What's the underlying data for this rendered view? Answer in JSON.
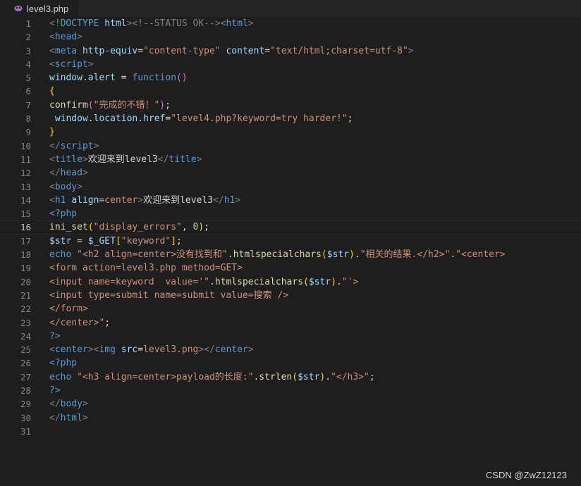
{
  "tab": {
    "filename": "level3.php",
    "icon": "php-file-icon"
  },
  "editor": {
    "current_line": 16,
    "lines": [
      {
        "n": "1",
        "tokens": [
          [
            "t-punc",
            "<!"
          ],
          [
            "t-tag",
            "DOCTYPE"
          ],
          [
            "t-plain",
            " "
          ],
          [
            "t-attr",
            "html"
          ],
          [
            "t-punc",
            "><!--STATUS OK--><"
          ],
          [
            "t-tag",
            "html"
          ],
          [
            "t-punc",
            ">"
          ]
        ]
      },
      {
        "n": "2",
        "tokens": [
          [
            "t-punc",
            "<"
          ],
          [
            "t-tag",
            "head"
          ],
          [
            "t-punc",
            ">"
          ]
        ]
      },
      {
        "n": "3",
        "tokens": [
          [
            "t-punc",
            "<"
          ],
          [
            "t-tag",
            "meta"
          ],
          [
            "t-plain",
            " "
          ],
          [
            "t-attr",
            "http-equiv"
          ],
          [
            "t-plain",
            "="
          ],
          [
            "t-str",
            "\"content-type\""
          ],
          [
            "t-plain",
            " "
          ],
          [
            "t-attr",
            "content"
          ],
          [
            "t-plain",
            "="
          ],
          [
            "t-str",
            "\"text/html;charset=utf-8\""
          ],
          [
            "t-punc",
            ">"
          ]
        ]
      },
      {
        "n": "4",
        "tokens": [
          [
            "t-punc",
            "<"
          ],
          [
            "t-tag",
            "script"
          ],
          [
            "t-punc",
            ">"
          ]
        ]
      },
      {
        "n": "5",
        "tokens": [
          [
            "t-var",
            "window"
          ],
          [
            "t-plain",
            "."
          ],
          [
            "t-var",
            "alert"
          ],
          [
            "t-plain",
            " = "
          ],
          [
            "t-kw",
            "function"
          ],
          [
            "t-paren",
            "()"
          ]
        ]
      },
      {
        "n": "6",
        "tokens": [
          [
            "t-brace",
            "{"
          ]
        ]
      },
      {
        "n": "7",
        "tokens": [
          [
            "t-fn",
            "confirm"
          ],
          [
            "t-paren",
            "("
          ],
          [
            "t-str",
            "\"完成的不错！\""
          ],
          [
            "t-paren",
            ")"
          ],
          [
            "t-plain",
            ";"
          ]
        ]
      },
      {
        "n": "8",
        "tokens": [
          [
            "t-plain",
            " "
          ],
          [
            "t-var",
            "window"
          ],
          [
            "t-plain",
            "."
          ],
          [
            "t-var",
            "location"
          ],
          [
            "t-plain",
            "."
          ],
          [
            "t-var",
            "href"
          ],
          [
            "t-plain",
            "="
          ],
          [
            "t-str",
            "\"level4.php?keyword=try harder!\""
          ],
          [
            "t-plain",
            ";"
          ]
        ]
      },
      {
        "n": "9",
        "tokens": [
          [
            "t-brace",
            "}"
          ]
        ]
      },
      {
        "n": "10",
        "tokens": [
          [
            "t-punc",
            "</"
          ],
          [
            "t-tag",
            "script"
          ],
          [
            "t-punc",
            ">"
          ]
        ]
      },
      {
        "n": "11",
        "tokens": [
          [
            "t-punc",
            "<"
          ],
          [
            "t-tag",
            "title"
          ],
          [
            "t-punc",
            ">"
          ],
          [
            "t-plain",
            "欢迎来到level3"
          ],
          [
            "t-punc",
            "</"
          ],
          [
            "t-tag",
            "title"
          ],
          [
            "t-punc",
            ">"
          ]
        ]
      },
      {
        "n": "12",
        "tokens": [
          [
            "t-punc",
            "</"
          ],
          [
            "t-tag",
            "head"
          ],
          [
            "t-punc",
            ">"
          ]
        ]
      },
      {
        "n": "13",
        "tokens": [
          [
            "t-punc",
            "<"
          ],
          [
            "t-tag",
            "body"
          ],
          [
            "t-punc",
            ">"
          ]
        ]
      },
      {
        "n": "14",
        "tokens": [
          [
            "t-punc",
            "<"
          ],
          [
            "t-tag",
            "h1"
          ],
          [
            "t-plain",
            " "
          ],
          [
            "t-attr",
            "align"
          ],
          [
            "t-plain",
            "="
          ],
          [
            "t-str",
            "center"
          ],
          [
            "t-punc",
            ">"
          ],
          [
            "t-plain",
            "欢迎来到level3"
          ],
          [
            "t-punc",
            "</"
          ],
          [
            "t-tag",
            "h1"
          ],
          [
            "t-punc",
            ">"
          ]
        ]
      },
      {
        "n": "15",
        "tokens": [
          [
            "t-php",
            "<?php"
          ]
        ]
      },
      {
        "n": "16",
        "tokens": [
          [
            "t-fn",
            "ini_set"
          ],
          [
            "t-brace",
            "("
          ],
          [
            "t-str",
            "\"display_errors\""
          ],
          [
            "t-plain",
            ", "
          ],
          [
            "t-num",
            "0"
          ],
          [
            "t-brace",
            ")"
          ],
          [
            "t-plain",
            ";"
          ]
        ]
      },
      {
        "n": "17",
        "tokens": [
          [
            "t-var",
            "$str"
          ],
          [
            "t-plain",
            " = "
          ],
          [
            "t-var",
            "$_GET"
          ],
          [
            "t-brace",
            "["
          ],
          [
            "t-str",
            "\"keyword\""
          ],
          [
            "t-brace",
            "]"
          ],
          [
            "t-plain",
            ";"
          ]
        ]
      },
      {
        "n": "18",
        "tokens": [
          [
            "t-kw",
            "echo"
          ],
          [
            "t-plain",
            " "
          ],
          [
            "t-str",
            "\"<h2 align=center>没有找到和\""
          ],
          [
            "t-plain",
            "."
          ],
          [
            "t-fn",
            "htmlspecialchars"
          ],
          [
            "t-brace",
            "("
          ],
          [
            "t-var",
            "$str"
          ],
          [
            "t-brace",
            ")"
          ],
          [
            "t-plain",
            "."
          ],
          [
            "t-str",
            "\"相关的结果.</h2>\""
          ],
          [
            "t-plain",
            "."
          ],
          [
            "t-str",
            "\"<center>"
          ]
        ]
      },
      {
        "n": "19",
        "tokens": [
          [
            "t-str",
            "<form action=level3.php method=GET>"
          ]
        ]
      },
      {
        "n": "20",
        "tokens": [
          [
            "t-str",
            "<input name=keyword  value='\""
          ],
          [
            "t-plain",
            "."
          ],
          [
            "t-fn",
            "htmlspecialchars"
          ],
          [
            "t-brace",
            "("
          ],
          [
            "t-var",
            "$str"
          ],
          [
            "t-brace",
            ")"
          ],
          [
            "t-plain",
            "."
          ],
          [
            "t-str",
            "\"'>"
          ]
        ]
      },
      {
        "n": "21",
        "tokens": [
          [
            "t-str",
            "<input type=submit name=submit value=搜索 />"
          ]
        ]
      },
      {
        "n": "22",
        "tokens": [
          [
            "t-str",
            "</form>"
          ]
        ]
      },
      {
        "n": "23",
        "tokens": [
          [
            "t-str",
            "</center>\""
          ],
          [
            "t-plain",
            ";"
          ]
        ]
      },
      {
        "n": "24",
        "tokens": [
          [
            "t-php",
            "?>"
          ]
        ]
      },
      {
        "n": "25",
        "tokens": [
          [
            "t-punc",
            "<"
          ],
          [
            "t-tag",
            "center"
          ],
          [
            "t-punc",
            "><"
          ],
          [
            "t-tag",
            "img"
          ],
          [
            "t-plain",
            " "
          ],
          [
            "t-attr",
            "src"
          ],
          [
            "t-plain",
            "="
          ],
          [
            "t-str",
            "level3.png"
          ],
          [
            "t-punc",
            "></"
          ],
          [
            "t-tag",
            "center"
          ],
          [
            "t-punc",
            ">"
          ]
        ]
      },
      {
        "n": "26",
        "tokens": [
          [
            "t-php",
            "<?php"
          ]
        ]
      },
      {
        "n": "27",
        "tokens": [
          [
            "t-kw",
            "echo"
          ],
          [
            "t-plain",
            " "
          ],
          [
            "t-str",
            "\"<h3 align=center>payload的长度:\""
          ],
          [
            "t-plain",
            "."
          ],
          [
            "t-fn",
            "strlen"
          ],
          [
            "t-brace",
            "("
          ],
          [
            "t-var",
            "$str"
          ],
          [
            "t-brace",
            ")"
          ],
          [
            "t-plain",
            "."
          ],
          [
            "t-str",
            "\"</h3>\""
          ],
          [
            "t-plain",
            ";"
          ]
        ]
      },
      {
        "n": "28",
        "tokens": [
          [
            "t-php",
            "?>"
          ]
        ]
      },
      {
        "n": "29",
        "tokens": [
          [
            "t-punc",
            "</"
          ],
          [
            "t-tag",
            "body"
          ],
          [
            "t-punc",
            ">"
          ]
        ]
      },
      {
        "n": "30",
        "tokens": [
          [
            "t-punc",
            "</"
          ],
          [
            "t-tag",
            "html"
          ],
          [
            "t-punc",
            ">"
          ]
        ]
      },
      {
        "n": "31",
        "tokens": []
      }
    ]
  },
  "watermark": "CSDN @ZwZ12123"
}
